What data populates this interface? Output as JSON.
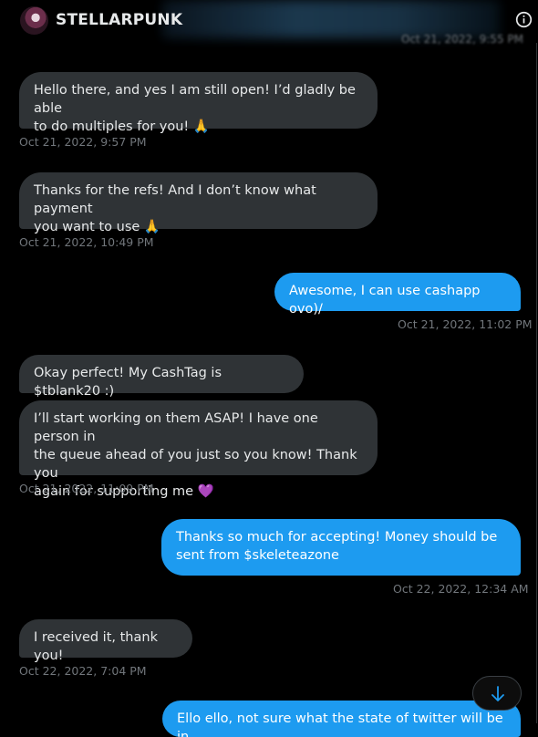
{
  "header": {
    "title": "STELLARPUNK",
    "top_timestamp": "Oct 21, 2022, 9:55 PM"
  },
  "messages": [
    {
      "dir": "in",
      "lines": [
        "Hello there, and yes I am still open! I’d gladly be able",
        "to do multiples for you! 🙏"
      ],
      "timestamp": "Oct 21, 2022, 9:57 PM"
    },
    {
      "dir": "in",
      "lines": [
        "Thanks for the refs! And I don’t know what payment",
        "you want to use 🙏"
      ],
      "timestamp": "Oct 21, 2022, 10:49 PM"
    },
    {
      "dir": "out",
      "lines": [
        "Awesome, I can use cashapp ovo)/"
      ],
      "timestamp": "Oct 21, 2022, 11:02 PM"
    },
    {
      "dir": "in",
      "lines": [
        "Okay perfect! My CashTag is $tblank20 :)"
      ]
    },
    {
      "dir": "in",
      "lines": [
        "I’ll start working on them ASAP! I have one person in",
        "the queue ahead of you just so you know! Thank you",
        "again for supporting me 💜"
      ],
      "timestamp": "Oct 21, 2022, 11:09 PM"
    },
    {
      "dir": "out",
      "lines": [
        "Thanks so much for accepting! Money should be",
        "sent from $skeleteazone"
      ],
      "timestamp": "Oct 22, 2022, 12:34 AM"
    },
    {
      "dir": "in",
      "lines": [
        "I received it, thank you!"
      ],
      "timestamp": "Oct 22, 2022, 7:04 PM"
    },
    {
      "dir": "out",
      "lines": [
        "Ello ello, not sure what the state of twitter will be in"
      ]
    }
  ],
  "colors": {
    "incoming": "#2f3336",
    "outgoing": "#1d9bf0",
    "timestamp": "#71767b"
  },
  "icons": {
    "info": "info-icon",
    "scroll": "arrow-down-icon",
    "avatar": "avatar"
  }
}
